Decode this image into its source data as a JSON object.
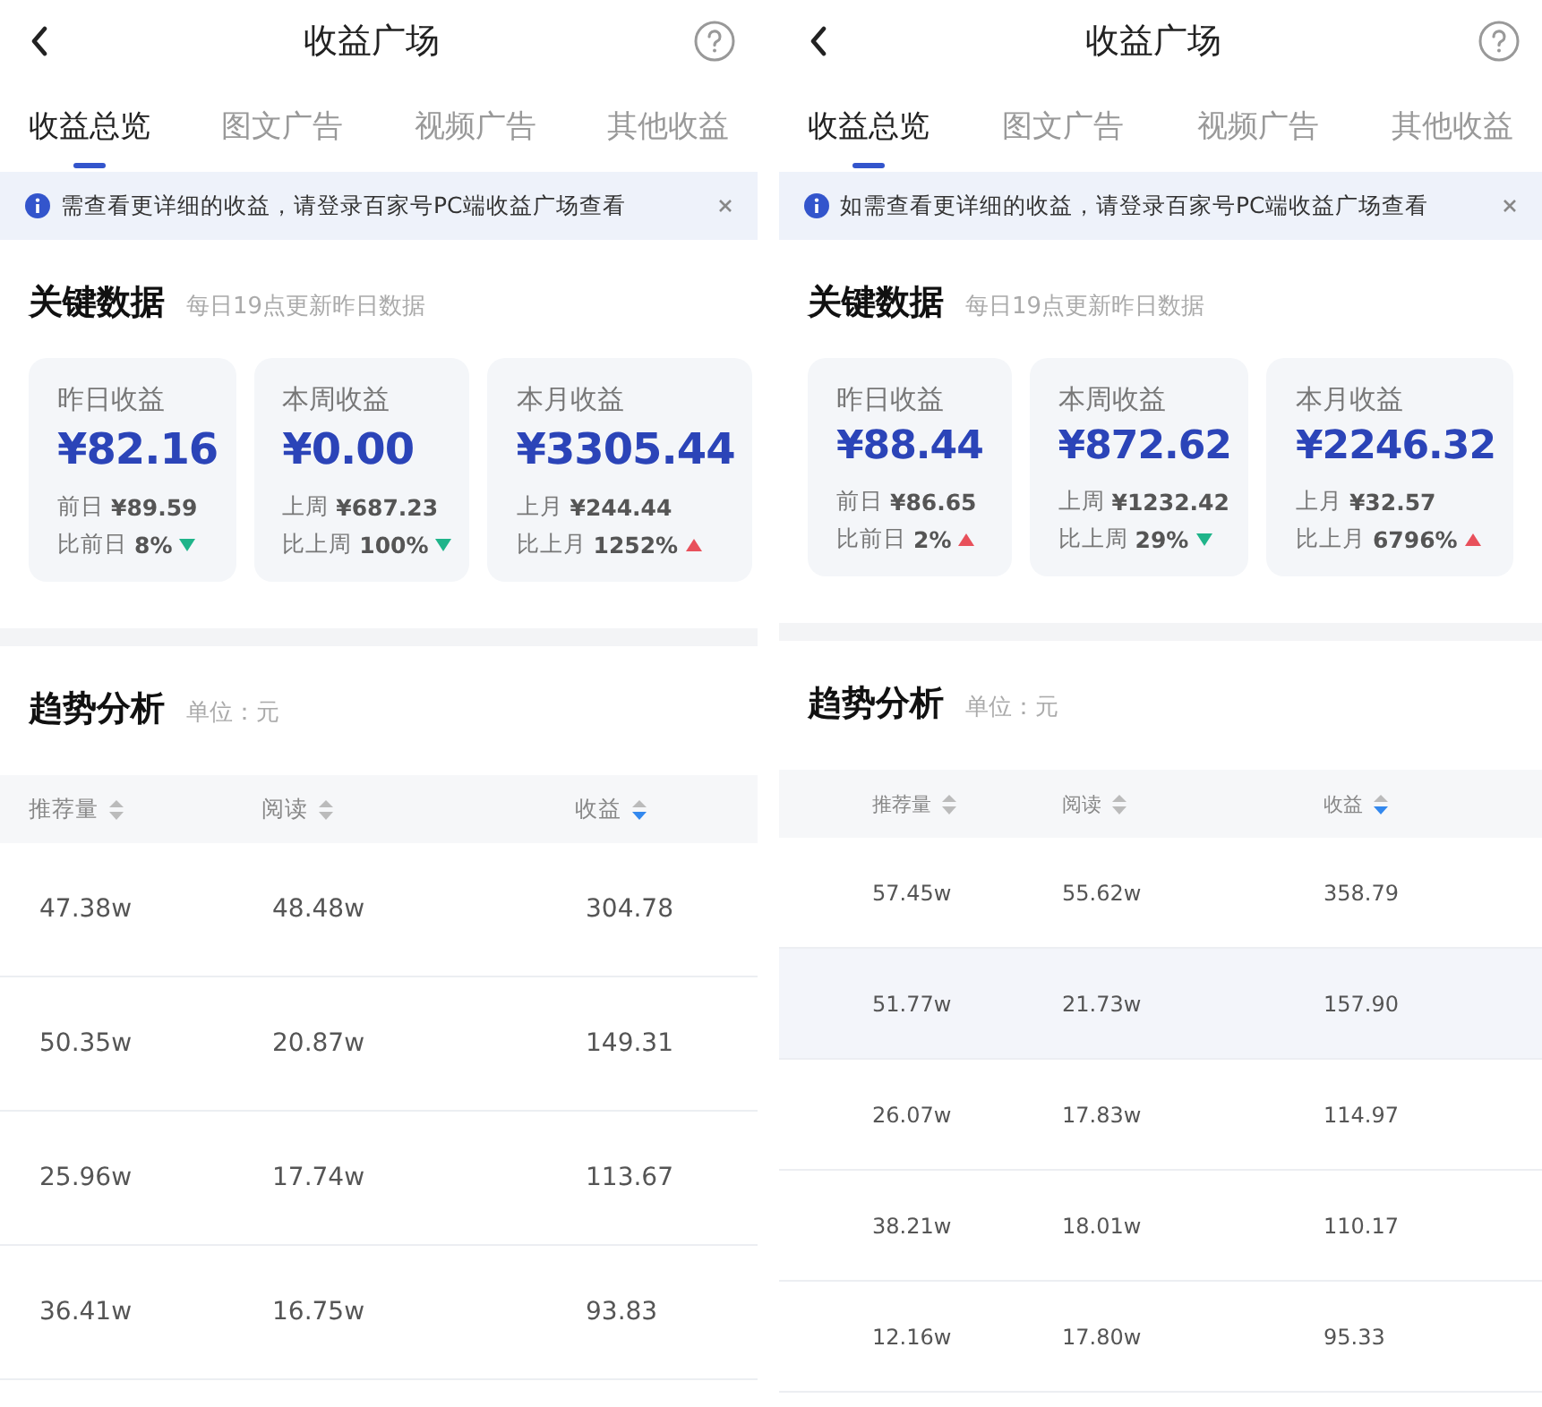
{
  "screens": [
    {
      "title": "收益广场",
      "tabs": [
        {
          "label": "收益总览",
          "selected": true
        },
        {
          "label": "图文广告",
          "selected": false
        },
        {
          "label": "视频广告",
          "selected": false
        },
        {
          "label": "其他收益",
          "selected": false
        }
      ],
      "notice": "需查看更详细的收益，请登录百家号PC端收益广场查看",
      "key_data": {
        "title": "关键数据",
        "subtitle": "每日19点更新昨日数据",
        "cards": [
          {
            "label": "昨日收益",
            "amount": "¥82.16",
            "prev_label": "前日",
            "prev_value": "¥89.59",
            "compare_label": "比前日",
            "compare_value": "8%",
            "rising": false
          },
          {
            "label": "本周收益",
            "amount": "¥0.00",
            "prev_label": "上周",
            "prev_value": "¥687.23",
            "compare_label": "比上周",
            "compare_value": "100%",
            "rising": false
          },
          {
            "label": "本月收益",
            "amount": "¥3305.44",
            "prev_label": "上月",
            "prev_value": "¥244.44",
            "compare_label": "比上月",
            "compare_value": "1252%",
            "rising": true
          }
        ]
      },
      "trend": {
        "title": "趋势分析",
        "unit": "单位：元"
      },
      "table": {
        "columns": [
          {
            "label": "推荐量",
            "sorted": false
          },
          {
            "label": "阅读",
            "sorted": false
          },
          {
            "label": "收益",
            "sorted": true
          }
        ],
        "rows": [
          {
            "cells": [
              "47.38w",
              "48.48w",
              "304.78"
            ],
            "selected": false
          },
          {
            "cells": [
              "50.35w",
              "20.87w",
              "149.31"
            ],
            "selected": false
          },
          {
            "cells": [
              "25.96w",
              "17.74w",
              "113.67"
            ],
            "selected": false
          },
          {
            "cells": [
              "36.41w",
              "16.75w",
              "93.83"
            ],
            "selected": false
          }
        ]
      }
    },
    {
      "title": "收益广场",
      "tabs": [
        {
          "label": "收益总览",
          "selected": true
        },
        {
          "label": "图文广告",
          "selected": false
        },
        {
          "label": "视频广告",
          "selected": false
        },
        {
          "label": "其他收益",
          "selected": false
        }
      ],
      "notice": "如需查看更详细的收益，请登录百家号PC端收益广场查看",
      "key_data": {
        "title": "关键数据",
        "subtitle": "每日19点更新昨日数据",
        "cards": [
          {
            "label": "昨日收益",
            "amount": "¥88.44",
            "prev_label": "前日",
            "prev_value": "¥86.65",
            "compare_label": "比前日",
            "compare_value": "2%",
            "rising": true
          },
          {
            "label": "本周收益",
            "amount": "¥872.62",
            "prev_label": "上周",
            "prev_value": "¥1232.42",
            "compare_label": "比上周",
            "compare_value": "29%",
            "rising": false
          },
          {
            "label": "本月收益",
            "amount": "¥2246.32",
            "prev_label": "上月",
            "prev_value": "¥32.57",
            "compare_label": "比上月",
            "compare_value": "6796%",
            "rising": true
          }
        ]
      },
      "trend": {
        "title": "趋势分析",
        "unit": "单位：元"
      },
      "table": {
        "columns": [
          {
            "label": "推荐量",
            "sorted": false
          },
          {
            "label": "阅读",
            "sorted": false
          },
          {
            "label": "收益",
            "sorted": true
          }
        ],
        "rows": [
          {
            "cells": [
              "57.45w",
              "55.62w",
              "358.79"
            ],
            "selected": false
          },
          {
            "cells": [
              "51.77w",
              "21.73w",
              "157.90"
            ],
            "selected": true
          },
          {
            "cells": [
              "26.07w",
              "17.83w",
              "114.97"
            ],
            "selected": false
          },
          {
            "cells": [
              "38.21w",
              "18.01w",
              "110.17"
            ],
            "selected": false
          },
          {
            "cells": [
              "12.16w",
              "17.80w",
              "95.33"
            ],
            "selected": false
          }
        ]
      }
    }
  ]
}
